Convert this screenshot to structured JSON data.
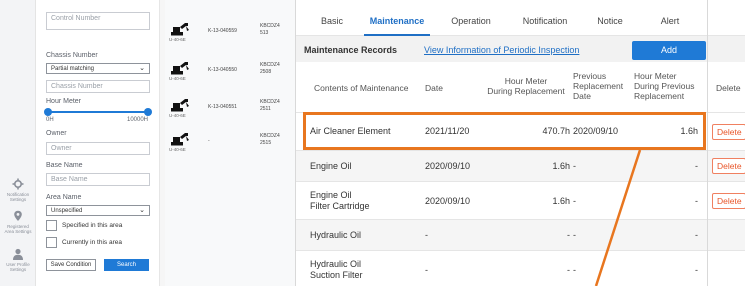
{
  "search_form": {
    "control_number_placeholder": "Control Number",
    "chassis_number_label": "Chassis Number",
    "chassis_match_select": "Partial matching",
    "chassis_number_placeholder": "Chassis Number",
    "hour_meter_label": "Hour Meter",
    "hour_meter_min": "0H",
    "hour_meter_max": "10000H",
    "hour_meter_range_fraction": [
      0.0,
      1.0
    ],
    "owner_label": "Owner",
    "owner_placeholder": "Owner",
    "base_name_label": "Base Name",
    "base_name_placeholder": "Base Name",
    "area_name_label": "Area Name",
    "area_select": "Unspecified",
    "specified_in_area": "Specified in this area",
    "currently_in_area": "Currently in this area",
    "save_condition": "Save Condition",
    "search": "Search"
  },
  "side_nav": [
    {
      "label": "Notification Settings",
      "icon": "gear-icon"
    },
    {
      "label": "Registered Area Settings",
      "icon": "location-pin-icon"
    },
    {
      "label": "User Profile Settings",
      "icon": "user-icon"
    }
  ],
  "machines": [
    {
      "model": "U-40-6E",
      "serial": "K-13-040559",
      "code": [
        "KBCDZ4",
        "513"
      ]
    },
    {
      "model": "U-40-6E",
      "serial": "K-13-040550",
      "code": [
        "KBCDZ4",
        "2508"
      ]
    },
    {
      "model": "U-40-6E",
      "serial": "K-13-040551",
      "code": [
        "KBCDZ4",
        "2511"
      ]
    },
    {
      "model": "U-40-6E",
      "serial": "-",
      "code": [
        "KBCDZ4",
        "2515"
      ]
    }
  ],
  "tabs": [
    "Basic",
    "Maintenance",
    "Operation",
    "Notification",
    "Notice",
    "Alert"
  ],
  "active_tab": "Maintenance",
  "maintenance": {
    "title": "Maintenance Records",
    "link": "View Information of Periodic Inspection",
    "add_button": "Add",
    "headers": {
      "contents": "Contents of Maintenance",
      "date": "Date",
      "hour_meter": [
        "Hour Meter",
        "During Replacement"
      ],
      "previous_date": [
        "Previous",
        "Replacement",
        "Date"
      ],
      "previous_hour": [
        "Hour Meter",
        "During Previous",
        "Replacement"
      ],
      "delete": "Delete"
    },
    "rows": [
      {
        "contents": [
          "Air Cleaner Element"
        ],
        "date": "2021/11/20",
        "hour": "470.7h",
        "prev_date": "2020/09/10",
        "prev_hour": "1.6h",
        "delete": "Delete"
      },
      {
        "contents": [
          "Engine Oil"
        ],
        "date": "2020/09/10",
        "hour": "1.6h",
        "prev_date": "-",
        "prev_hour": "-",
        "delete": "Delete"
      },
      {
        "contents": [
          "Engine Oil",
          "Filter Cartridge"
        ],
        "date": "2020/09/10",
        "hour": "1.6h",
        "prev_date": "-",
        "prev_hour": "-",
        "delete": "Delete"
      },
      {
        "contents": [
          "Hydraulic Oil"
        ],
        "date": "-",
        "hour": "-",
        "prev_date": "-",
        "prev_hour": "-",
        "delete": ""
      },
      {
        "contents": [
          "Hydraulic Oil",
          "Suction Filter"
        ],
        "date": "-",
        "hour": "-",
        "prev_date": "-",
        "prev_hour": "-",
        "delete": ""
      }
    ]
  },
  "colors": {
    "accent": "#1f7ad6",
    "highlight": "#e8761f",
    "delete": "#e8562a"
  }
}
